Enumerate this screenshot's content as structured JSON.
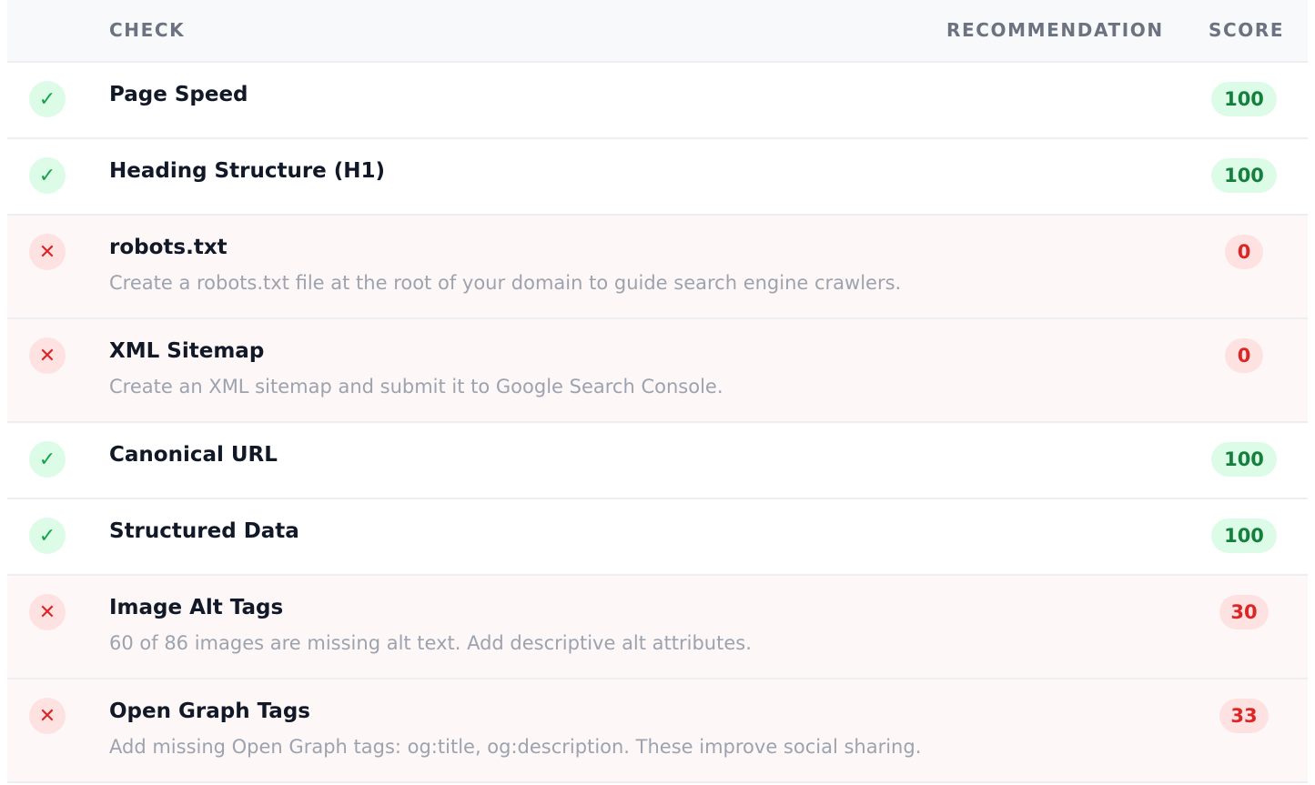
{
  "header": {
    "check": "CHECK",
    "recommendation": "RECOMMENDATION",
    "score": "SCORE"
  },
  "icons": {
    "pass": "✓",
    "fail": "✕"
  },
  "colors": {
    "pass": "#16a34a",
    "fail": "#dc2626"
  },
  "rows": [
    {
      "status": "pass",
      "name": "Page Speed",
      "recommendation": "",
      "score": "100"
    },
    {
      "status": "pass",
      "name": "Heading Structure (H1)",
      "recommendation": "",
      "score": "100"
    },
    {
      "status": "fail",
      "name": "robots.txt",
      "recommendation": "Create a robots.txt file at the root of your domain to guide search engine crawlers.",
      "score": "0"
    },
    {
      "status": "fail",
      "name": "XML Sitemap",
      "recommendation": "Create an XML sitemap and submit it to Google Search Console.",
      "score": "0"
    },
    {
      "status": "pass",
      "name": "Canonical URL",
      "recommendation": "",
      "score": "100"
    },
    {
      "status": "pass",
      "name": "Structured Data",
      "recommendation": "",
      "score": "100"
    },
    {
      "status": "fail",
      "name": "Image Alt Tags",
      "recommendation": "60 of 86 images are missing alt text. Add descriptive alt attributes.",
      "score": "30"
    },
    {
      "status": "fail",
      "name": "Open Graph Tags",
      "recommendation": "Add missing Open Graph tags: og:title, og:description. These improve social sharing.",
      "score": "33"
    }
  ]
}
